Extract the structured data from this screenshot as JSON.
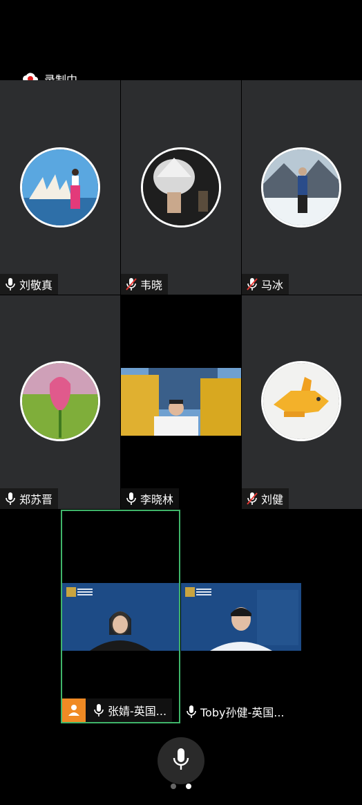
{
  "recording": {
    "label": "录制中",
    "icon": "cloud-record-icon",
    "color": "#e02020"
  },
  "participants": [
    {
      "name": "刘敬真",
      "mic": "on",
      "avatar": "opera-house-photo"
    },
    {
      "name": "韦晓",
      "mic": "muted",
      "avatar": "sculpture-photo"
    },
    {
      "name": "马冰",
      "mic": "muted",
      "avatar": "glacier-photo"
    },
    {
      "name": "郑苏晋",
      "mic": "on",
      "avatar": "tulip-photo"
    },
    {
      "name": "李晓林",
      "mic": "on",
      "video": "on"
    },
    {
      "name": "刘健",
      "mic": "muted",
      "avatar": "toy-fish-photo"
    },
    {
      "name": "张婧-英国...",
      "mic": "on",
      "video": "on",
      "active_speaker": true,
      "badge_icon": "person-icon"
    },
    {
      "name": "Toby孙健-英国...",
      "mic": "on",
      "video": "on"
    }
  ],
  "controls": {
    "mic_icon": "microphone-icon"
  },
  "pager": {
    "pages": 2,
    "current": 2
  },
  "colors": {
    "tile_bg": "#2c2d2f",
    "active_border": "#3fb56a",
    "badge": "#f08a24",
    "muted_red": "#e53935"
  }
}
